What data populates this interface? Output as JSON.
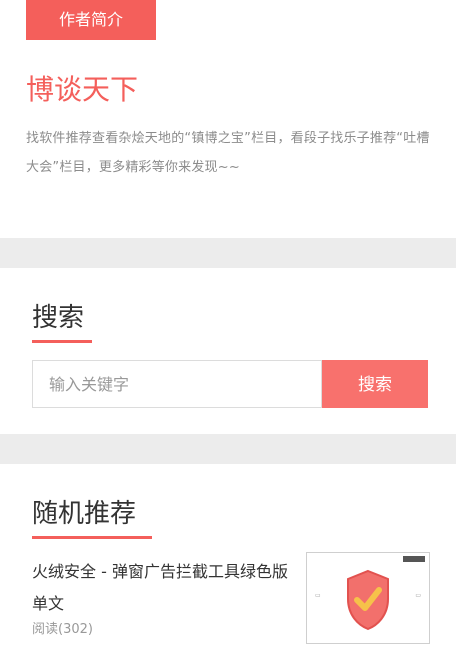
{
  "author": {
    "tag": "作者简介",
    "name": "博谈天下",
    "description": "找软件推荐查看杂烩天地的“镇博之宝”栏目，看段子找乐子推荐“吐槽大会”栏目，更多精彩等你来发现~~"
  },
  "search": {
    "title": "搜索",
    "placeholder": "输入关键字",
    "button_label": "搜索"
  },
  "random": {
    "title": "随机推荐",
    "item": {
      "title": "火绒安全 - 弹窗广告拦截工具绿色版单文",
      "meta": "阅读(302)",
      "thumbnail_icon": "shield-check-icon"
    }
  },
  "colors": {
    "accent": "#f45f5b",
    "button": "#f8716d",
    "background": "#ececec"
  }
}
